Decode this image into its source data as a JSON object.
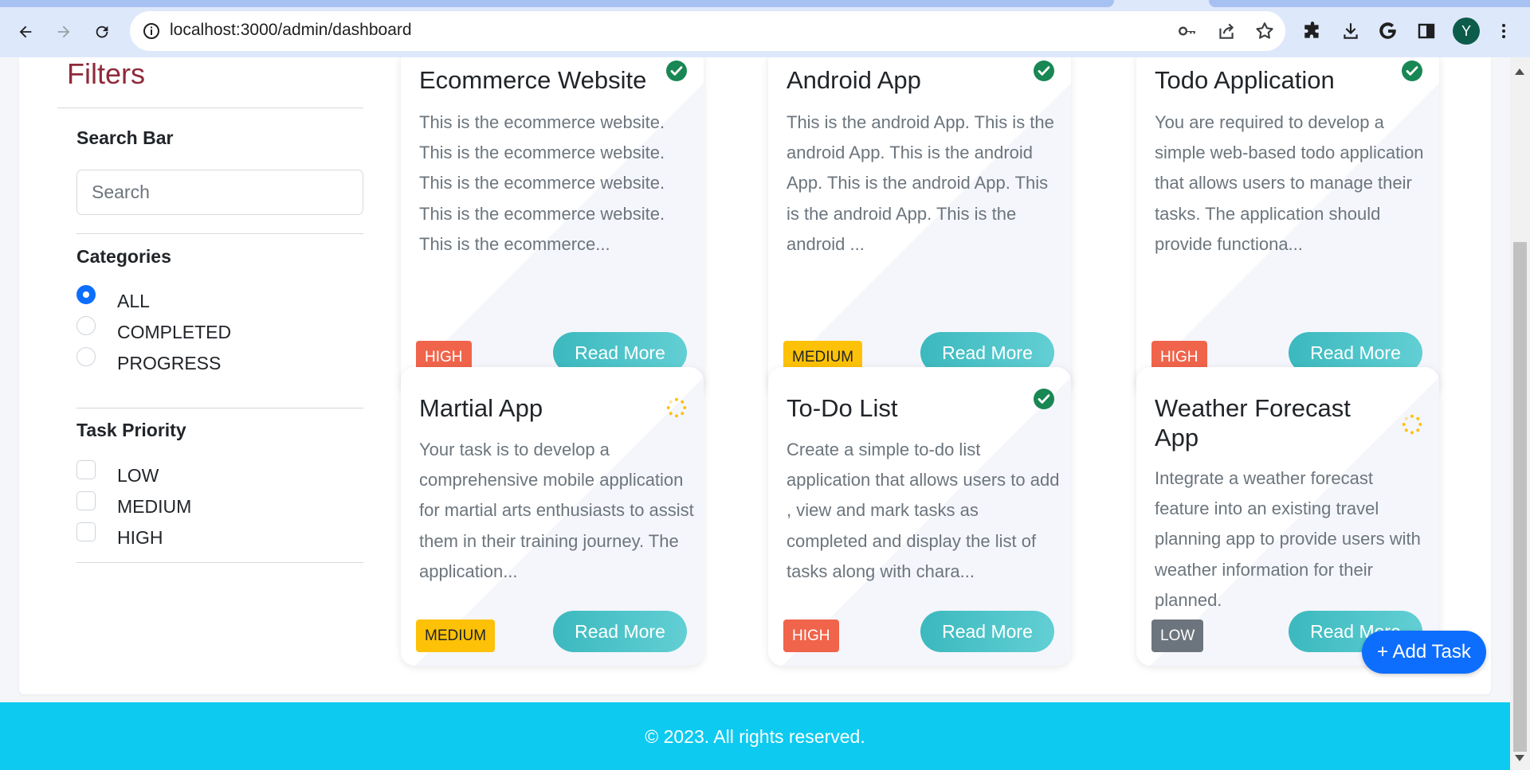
{
  "browser": {
    "url": "localhost:3000/admin/dashboard",
    "profile_initial": "Y"
  },
  "filters": {
    "title": "Filters",
    "search_heading": "Search Bar",
    "search_placeholder": "Search",
    "categories_heading": "Categories",
    "categories": [
      {
        "label": "ALL",
        "checked": true
      },
      {
        "label": "COMPLETED",
        "checked": false
      },
      {
        "label": "PROGRESS",
        "checked": false
      }
    ],
    "priority_heading": "Task Priority",
    "priorities": [
      {
        "label": "LOW",
        "checked": false
      },
      {
        "label": "MEDIUM",
        "checked": false
      },
      {
        "label": "HIGH",
        "checked": false
      }
    ]
  },
  "tasks": [
    {
      "title": "Ecommerce Website",
      "description": "This is the ecommerce website. This is the ecommerce website. This is the ecommerce website. This is the ecommerce website. This is the ecommerce...",
      "priority": "HIGH",
      "status": "completed",
      "button": "Read More"
    },
    {
      "title": "Android App",
      "description": "This is the android App. This is the android App. This is the android App. This is the android App. This is the android App. This is the android ...",
      "priority": "MEDIUM",
      "status": "completed",
      "button": "Read More"
    },
    {
      "title": "Todo Application",
      "description": "You are required to develop a simple web-based todo application that allows users to manage their tasks. The application should provide functiona...",
      "priority": "HIGH",
      "status": "completed",
      "button": "Read More"
    },
    {
      "title": "Martial App",
      "description": "Your task is to develop a comprehensive mobile application for martial arts enthusiasts to assist them in their training journey. The application...",
      "priority": "MEDIUM",
      "status": "progress",
      "button": "Read More"
    },
    {
      "title": "To-Do List",
      "description": "Create a simple to-do list application that allows users to add , view and mark tasks as completed and display the list of tasks along with chara...",
      "priority": "HIGH",
      "status": "completed",
      "button": "Read More"
    },
    {
      "title": "Weather Forecast App",
      "description": "Integrate a weather forecast feature into an existing travel planning app to provide users with weather information for their planned.",
      "priority": "LOW",
      "status": "progress",
      "button": "Read More"
    }
  ],
  "add_task_label": "+ Add Task",
  "footer_text": "© 2023. All rights reserved.",
  "colors": {
    "filters_title": "#8f2a3a",
    "high": "#f0644b",
    "medium": "#fdc107",
    "low": "#6c757d",
    "read_more": "#3bb9be",
    "primary": "#0d6efd",
    "footer": "#0dcaf0",
    "completed_icon": "#198754",
    "progress_icon": "#fdc107"
  },
  "icons": {
    "completed": "check-circle-icon",
    "progress": "spinner-icon"
  }
}
